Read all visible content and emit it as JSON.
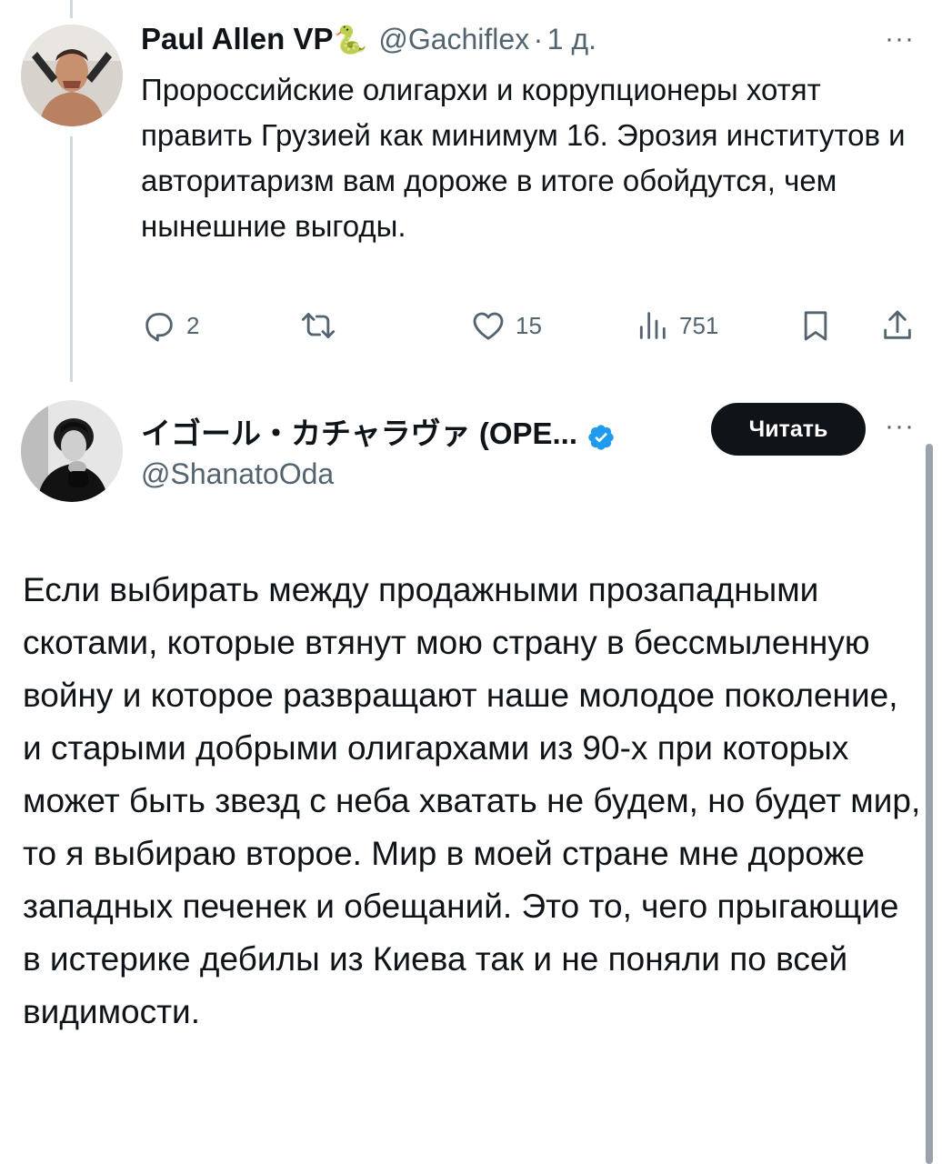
{
  "tweet1": {
    "author_name": "Paul Allen VP",
    "author_emoji": "🐍",
    "handle": "@Gachiflex",
    "separator": "·",
    "time": "1 д.",
    "more_label": "···",
    "text": "Пророссийские олигархи и коррупционеры хотят править Грузией как минимум 16. Эрозия институтов и авторитаризм вам дороже в итоге обойдутся, чем нынешние выгоды.",
    "actions": {
      "reply_count": "2",
      "repost_count": "",
      "like_count": "15",
      "views_count": "751"
    },
    "icons": [
      "reply-icon",
      "repost-icon",
      "like-icon",
      "views-icon",
      "bookmark-icon",
      "share-icon"
    ]
  },
  "tweet2": {
    "author_name": "イゴール・カチャラヴァ (OPE...",
    "handle": "@ShanatoOda",
    "verified_color": "#1d9bf0",
    "follow_label": "Читать",
    "more_label": "···",
    "text": "Если выбирать между продажными прозападными скотами, которые втянут мою страну в бессмыленную войну и которое развращают наше молодое поколение, и старыми добрыми олигархами из 90-х при которых может быть звезд с неба хватать не будем, но будет мир, то я выбираю второе. Мир в моей стране мне дороже западных печенек и обещаний. Это то, чего прыгающие в истерике дебилы из Киева так и не поняли по всей видимости."
  },
  "colors": {
    "text": "#0f1419",
    "secondary": "#536471",
    "thread_line": "#cfd9de",
    "button_bg": "#0f1419"
  }
}
